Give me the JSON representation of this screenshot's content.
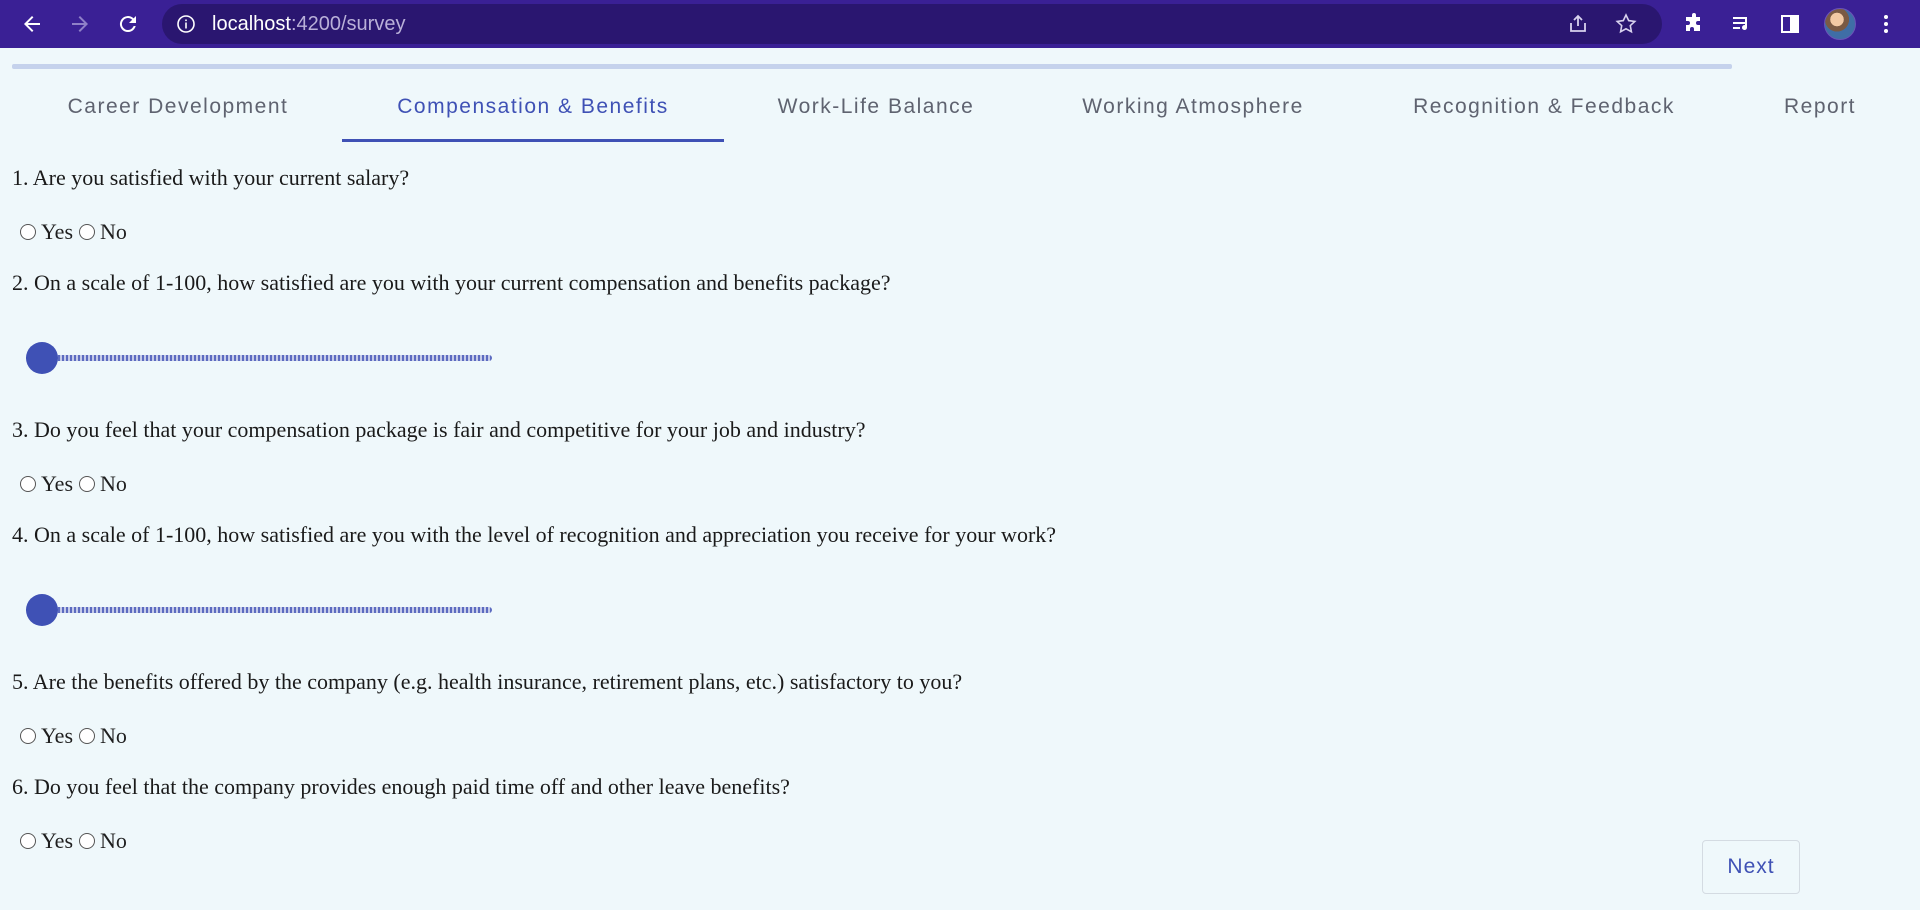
{
  "browser": {
    "url_host": "localhost",
    "url_path": ":4200/survey",
    "icons": [
      "back-icon",
      "forward-icon",
      "reload-icon",
      "info-icon",
      "share-icon",
      "star-icon",
      "extensions-icon",
      "reading-list-icon",
      "side-panel-icon",
      "avatar",
      "menu-icon"
    ]
  },
  "progress": {
    "value_percent": 100
  },
  "tabs": [
    {
      "label": "Career Development",
      "active": false
    },
    {
      "label": "Compensation & Benefits",
      "active": true
    },
    {
      "label": "Work-Life Balance",
      "active": false
    },
    {
      "label": "Working Atmosphere",
      "active": false
    },
    {
      "label": "Recognition & Feedback",
      "active": false
    },
    {
      "label": "Report",
      "active": false
    }
  ],
  "questions": [
    {
      "text": "1. Are you satisfied with your current salary?",
      "type": "radio",
      "options": [
        "Yes",
        "No"
      ]
    },
    {
      "text": "2. On a scale of 1-100, how satisfied are you with your current compensation and benefits package?",
      "type": "slider",
      "value": 1
    },
    {
      "text": "3. Do you feel that your compensation package is fair and competitive for your job and industry?",
      "type": "radio",
      "options": [
        "Yes",
        "No"
      ]
    },
    {
      "text": "4. On a scale of 1-100, how satisfied are you with the level of recognition and appreciation you receive for your work?",
      "type": "slider",
      "value": 1
    },
    {
      "text": "5. Are the benefits offered by the company (e.g. health insurance, retirement plans, etc.) satisfactory to you?",
      "type": "radio",
      "options": [
        "Yes",
        "No"
      ]
    },
    {
      "text": "6. Do you feel that the company provides enough paid time off and other leave benefits?",
      "type": "radio",
      "options": [
        "Yes",
        "No"
      ]
    }
  ],
  "next_label": "Next",
  "colors": {
    "accent": "#3f51b5",
    "chrome": "#3a2095",
    "background": "#eff8fb"
  }
}
